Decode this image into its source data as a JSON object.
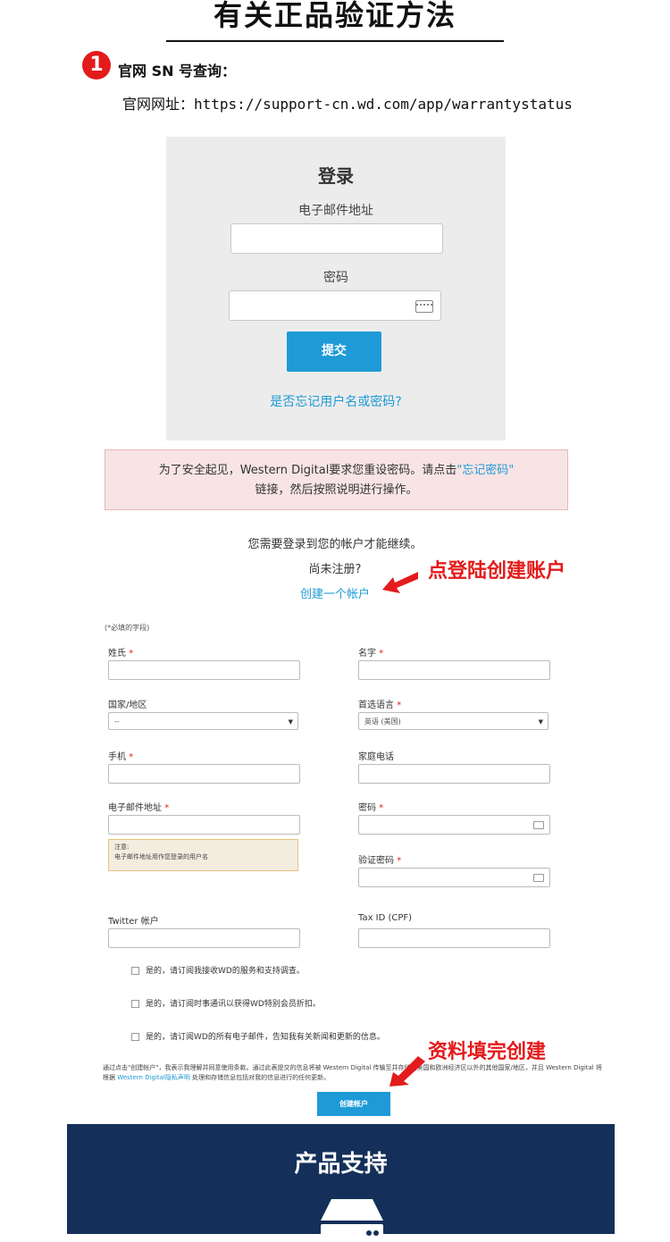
{
  "header": {
    "title": "有关正品验证方法",
    "step_number": "1",
    "step_title": "官网 SN 号查询：",
    "url_label": "官网网址：",
    "url": "https://support-cn.wd.com/app/warrantystatus"
  },
  "login": {
    "title": "登录",
    "email_label": "电子邮件地址",
    "email_value": "",
    "password_label": "密码",
    "password_value": "",
    "submit_label": "提交",
    "forgot_link": "是否忘记用户名或密码?"
  },
  "alert": {
    "text_before": "为了安全起见，Western Digital要求您重设密码。请点击",
    "link": "\"忘记密码\"",
    "text_after": "链接，然后按照说明进行操作。"
  },
  "account_prompt": {
    "line1": "您需要登录到您的帐户才能继续。",
    "line2": "尚未注册?",
    "create_link": "创建一个帐户",
    "annotation": "点登陆创建账户"
  },
  "register_form": {
    "required_note": "(*必填的字段)",
    "fields": {
      "last_name": "姓氏",
      "first_name": "名字",
      "country": "国家/地区",
      "country_value": "--",
      "language": "首选语言",
      "language_value": "英语 (美国)",
      "mobile": "手机",
      "home_phone": "家庭电话",
      "email": "电子邮件地址",
      "password": "密码",
      "confirm_password": "验证密码",
      "twitter": "Twitter 帐户",
      "tax_id": "Tax ID (CPF)"
    },
    "required_mark": "*",
    "note_title": "注意:",
    "note_body": "电子邮件地址用作您登录的用户名",
    "checkboxes": [
      "是的，请订阅我接收WD的服务和支持调查。",
      "是的，请订阅时事通讯以获得WD特别会员折扣。",
      "是的，请订阅WD的所有电子邮件，告知我有关新闻和更新的信息。"
    ],
    "legal_part1": "通过点击\"创建帐户\"，我表示我理解并同意使用条款。通过此表提交的信息将被 Western Digital 传输至并存储在美国和欧洲经济区以外的其他国家/地区，并且 Western Digital 将根据 ",
    "legal_link": "Western Digital隐私声明",
    "legal_part2": " 处理和存储信息包括对我的信息进行的任何更新。",
    "create_button": "创建帐户",
    "annotation": "资料填完创建"
  },
  "support": {
    "title": "产品支持"
  },
  "colors": {
    "accent": "#1e9ad6",
    "annotation_red": "#e31b1b",
    "support_bg": "#14305a"
  },
  "icons": [
    "keyboard-icon",
    "arrow-icon",
    "drive-icon"
  ]
}
